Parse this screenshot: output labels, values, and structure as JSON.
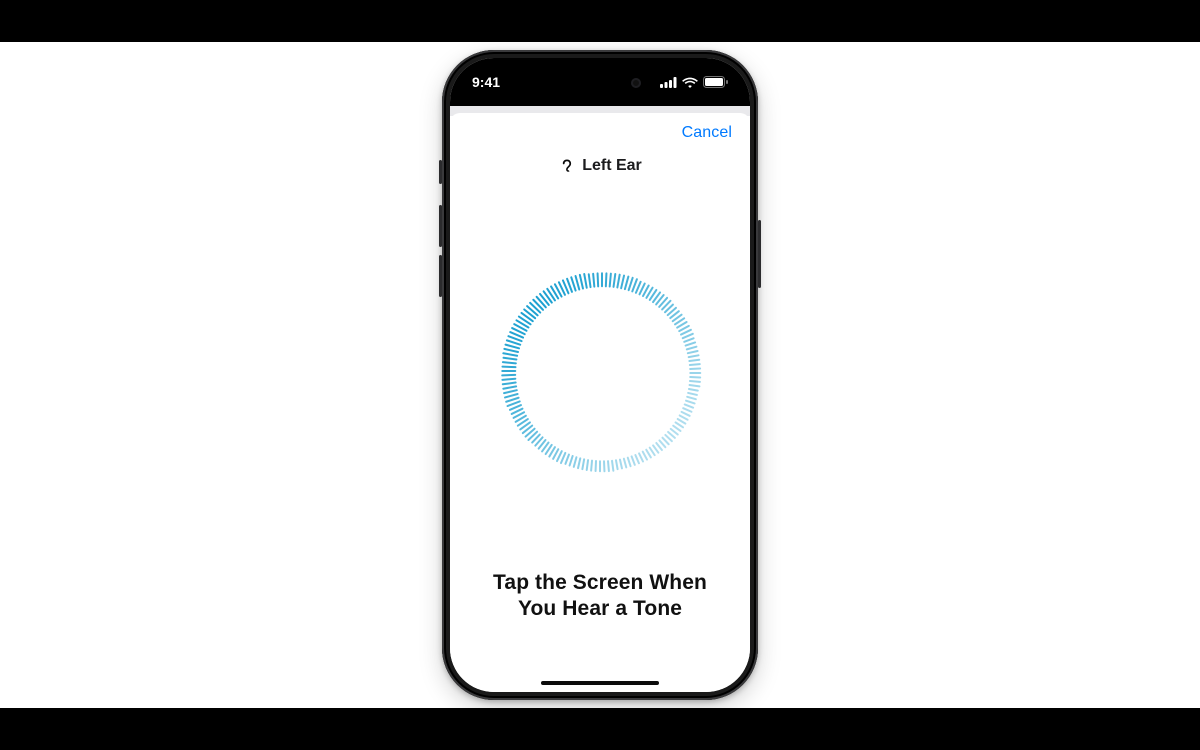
{
  "status": {
    "time": "9:41"
  },
  "sheet": {
    "cancel": "Cancel",
    "ear_label": "Left Ear",
    "instruction": "Tap the Screen When You Hear a Tone"
  },
  "colors": {
    "accent": "#007AFF",
    "ring": "#1ea1d1"
  }
}
